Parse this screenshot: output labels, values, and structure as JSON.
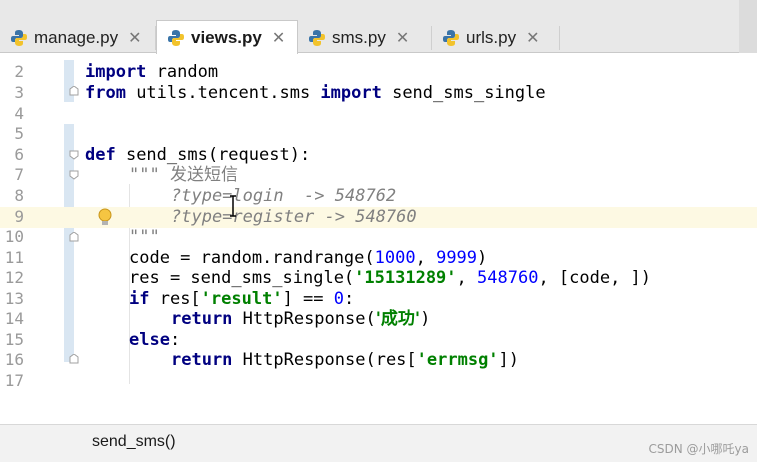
{
  "tabs": [
    {
      "label": "manage.py",
      "active": false,
      "close": "✕"
    },
    {
      "label": "views.py",
      "active": true,
      "close": "✕"
    },
    {
      "label": "sms.py",
      "active": false,
      "close": "✕"
    },
    {
      "label": "urls.py",
      "active": false,
      "close": "✕"
    }
  ],
  "line_numbers": [
    "2",
    "3",
    "4",
    "5",
    "6",
    "7",
    "8",
    "9",
    "10",
    "11",
    "12",
    "13",
    "14",
    "15",
    "16",
    "17"
  ],
  "code": {
    "l2": {
      "kw": "import",
      "rest": " random"
    },
    "l3": {
      "kw1": "from",
      "mod": " utils.tencent.sms ",
      "kw2": "import",
      "rest": " send_sms_single"
    },
    "l6": {
      "kw": "def",
      "rest": " send_sms(request):"
    },
    "l7": {
      "quote": "\"\"\" ",
      "text": "发送短信"
    },
    "l8": {
      "text": "?type=login  -> 548762"
    },
    "l9": {
      "text": "?type=register -> 548760"
    },
    "l10": {
      "text": "\"\"\""
    },
    "l11": {
      "a": "code = random.randrange(",
      "n1": "1000",
      "b": ", ",
      "n2": "9999",
      "c": ")"
    },
    "l12": {
      "a": "res = send_sms_single(",
      "s1": "'15131289'",
      "b": ", ",
      "n1": "548760",
      "c": ", [code, ])"
    },
    "l13": {
      "kw": "if",
      "a": " res[",
      "s1": "'result'",
      "b": "] == ",
      "n1": "0",
      "c": ":"
    },
    "l14": {
      "kw": "return",
      "a": " HttpResponse(",
      "s1": "'成功'",
      "c": ")"
    },
    "l15": {
      "kw": "else",
      "c": ":"
    },
    "l16": {
      "kw": "return",
      "a": " HttpResponse(res[",
      "s1": "'errmsg'",
      "c": "])"
    }
  },
  "breadcrumb": "send_sms()",
  "watermark": "CSDN @小哪吒ya",
  "colors": {
    "keyword": "#000080",
    "string": "#008000",
    "number": "#0000ff",
    "docstring": "#808080",
    "highlight": "#fdf9e3"
  },
  "icons": {
    "tab_file": "python-file-icon",
    "intention": "lightbulb-icon"
  }
}
